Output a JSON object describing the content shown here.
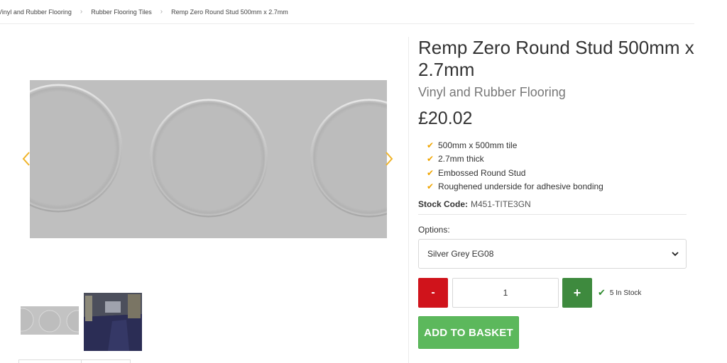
{
  "breadcrumb": {
    "items": [
      "Vinyl and Rubber Flooring",
      "Rubber Flooring Tiles",
      "Remp Zero Round Stud 500mm x 2.7mm"
    ],
    "separator": ">"
  },
  "gallery": {
    "prev_icon": "chevron-left-icon",
    "next_icon": "chevron-right-icon",
    "arrow_color": "#f0b429"
  },
  "product": {
    "title": "Remp Zero Round Stud 500mm x 2.7mm",
    "brand": "Vinyl and Rubber Flooring",
    "price": "£20.02",
    "features": [
      "500mm x 500mm tile",
      "2.7mm thick",
      "Embossed Round Stud",
      "Roughened underside for adhesive bonding"
    ],
    "feature_icon": "check-icon",
    "stock_code_label": "Stock Code:",
    "stock_code": "M451-TITE3GN",
    "options_label": "Options:",
    "selected_option": "Silver Grey EG08",
    "quantity": "1",
    "minus_label": "-",
    "plus_label": "+",
    "stock_status": "5 In Stock",
    "add_to_basket": "ADD TO BASKET"
  },
  "colors": {
    "minus": "#d0131b",
    "plus": "#3e8a3e",
    "basket": "#5cb85c",
    "feature_tick": "#f0a500",
    "stock_check": "#2e8b2e"
  }
}
